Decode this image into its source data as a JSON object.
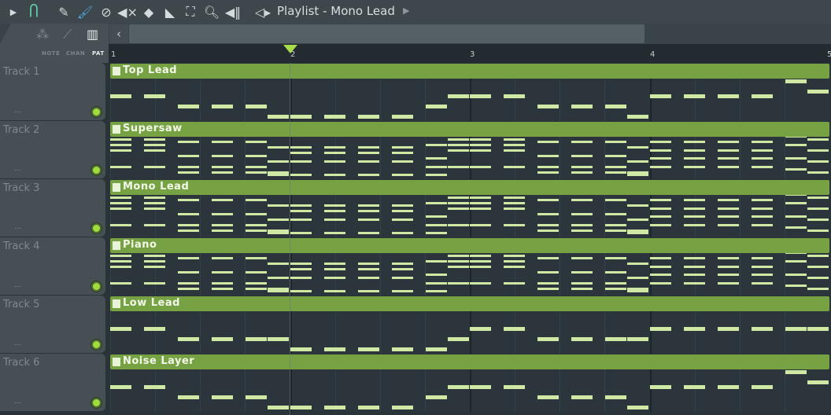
{
  "toolbar": {
    "icons": [
      "play-arrow-icon",
      "magnet-snap-icon",
      "pencil-icon",
      "paint-brush-icon",
      "delete-icon",
      "mute-icon",
      "slip-icon",
      "slice-icon",
      "select-icon",
      "zoom-icon",
      "playback-icon",
      "speaker-icon"
    ],
    "title": "Playlist - Mono Lead",
    "accent": "#5ed3b0",
    "selected_tool_color": "#52a8e0"
  },
  "left_panel": {
    "tabs": [
      "NOTE",
      "CHAN",
      "PAT"
    ],
    "active_tab": "PAT"
  },
  "ruler": {
    "bars": [
      "1",
      "2",
      "3",
      "4",
      "5"
    ],
    "playhead_bar": 2
  },
  "colors": {
    "clip": "#77a243",
    "note": "#cfe8a4",
    "led": "#9fdc3c"
  },
  "tracks": [
    {
      "name": "Track 1",
      "dots": "...",
      "clip": "Top Lead",
      "type": "mono",
      "notes": [
        4,
        4,
        2,
        2,
        2,
        0,
        0,
        0,
        0,
        0,
        2,
        4,
        4,
        4,
        2,
        2,
        2,
        0,
        4,
        4,
        4,
        4,
        7,
        5
      ]
    },
    {
      "name": "Track 2",
      "dots": "...",
      "clip": "Supersaw",
      "type": "chord",
      "notes": [
        [
          13,
          11,
          9,
          3
        ],
        [
          13,
          11,
          9,
          3
        ],
        [
          12,
          7,
          3,
          1
        ],
        [
          12,
          7,
          3,
          1
        ],
        [
          12,
          7,
          3,
          1
        ],
        [
          10,
          5,
          1,
          0
        ],
        [
          10,
          8,
          5,
          0
        ],
        [
          10,
          8,
          5,
          0
        ],
        [
          10,
          8,
          5,
          0
        ],
        [
          10,
          8,
          5,
          0
        ],
        [
          11,
          6,
          3,
          0
        ],
        [
          13,
          11,
          9,
          3
        ],
        [
          13,
          11,
          9,
          3
        ],
        [
          13,
          11,
          9,
          3
        ],
        [
          12,
          7,
          3,
          1
        ],
        [
          12,
          7,
          3,
          1
        ],
        [
          12,
          7,
          3,
          1
        ],
        [
          10,
          5,
          1,
          0
        ],
        [
          12,
          9,
          6,
          3
        ],
        [
          12,
          9,
          6,
          3
        ],
        [
          12,
          9,
          6,
          3
        ],
        [
          12,
          9,
          6,
          3
        ],
        [
          14,
          11,
          6,
          2
        ],
        [
          13,
          9,
          5,
          1
        ]
      ]
    },
    {
      "name": "Track 3",
      "dots": "...",
      "clip": "Mono Lead",
      "type": "chord",
      "notes": [
        [
          13,
          11,
          9,
          3
        ],
        [
          13,
          11,
          9,
          3
        ],
        [
          12,
          7,
          3,
          1
        ],
        [
          12,
          7,
          3,
          1
        ],
        [
          12,
          7,
          3,
          1
        ],
        [
          10,
          5,
          1,
          0
        ],
        [
          10,
          8,
          5,
          0
        ],
        [
          10,
          8,
          5,
          0
        ],
        [
          10,
          8,
          5,
          0
        ],
        [
          10,
          8,
          5,
          0
        ],
        [
          11,
          6,
          3,
          0
        ],
        [
          13,
          11,
          9,
          3
        ],
        [
          13,
          11,
          9,
          3
        ],
        [
          13,
          11,
          9,
          3
        ],
        [
          12,
          7,
          3,
          1
        ],
        [
          12,
          7,
          3,
          1
        ],
        [
          12,
          7,
          3,
          1
        ],
        [
          10,
          5,
          1,
          0
        ],
        [
          12,
          9,
          6,
          3
        ],
        [
          12,
          9,
          6,
          3
        ],
        [
          12,
          9,
          6,
          3
        ],
        [
          12,
          9,
          6,
          3
        ],
        [
          14,
          11,
          6,
          2
        ],
        [
          13,
          9,
          5,
          1
        ]
      ]
    },
    {
      "name": "Track 4",
      "dots": "...",
      "clip": "Piano",
      "type": "chord",
      "notes": [
        [
          13,
          11,
          9,
          3
        ],
        [
          13,
          11,
          9,
          3
        ],
        [
          12,
          7,
          3,
          1
        ],
        [
          12,
          7,
          3,
          1
        ],
        [
          12,
          7,
          3,
          1
        ],
        [
          10,
          5,
          1,
          0
        ],
        [
          10,
          8,
          5,
          0
        ],
        [
          10,
          8,
          5,
          0
        ],
        [
          10,
          8,
          5,
          0
        ],
        [
          10,
          8,
          5,
          0
        ],
        [
          11,
          6,
          3,
          0
        ],
        [
          13,
          11,
          9,
          3
        ],
        [
          13,
          11,
          9,
          3
        ],
        [
          13,
          11,
          9,
          3
        ],
        [
          12,
          7,
          3,
          1
        ],
        [
          12,
          7,
          3,
          1
        ],
        [
          12,
          7,
          3,
          1
        ],
        [
          10,
          5,
          1,
          0
        ],
        [
          12,
          9,
          6,
          3
        ],
        [
          12,
          9,
          6,
          3
        ],
        [
          12,
          9,
          6,
          3
        ],
        [
          12,
          9,
          6,
          3
        ],
        [
          14,
          11,
          6,
          2
        ],
        [
          13,
          9,
          5,
          1
        ]
      ]
    },
    {
      "name": "Track 5",
      "dots": "...",
      "clip": "Low Lead",
      "type": "mono",
      "notes": [
        4,
        4,
        2,
        2,
        2,
        2,
        0,
        0,
        0,
        0,
        0,
        2,
        4,
        4,
        2,
        2,
        2,
        2,
        4,
        4,
        4,
        4,
        4,
        4
      ]
    },
    {
      "name": "Track 6",
      "dots": "...",
      "clip": "Noise Layer",
      "type": "mono",
      "notes": [
        4,
        4,
        2,
        2,
        2,
        0,
        0,
        0,
        0,
        0,
        2,
        4,
        4,
        4,
        2,
        2,
        2,
        0,
        4,
        4,
        4,
        4,
        7,
        5
      ]
    }
  ]
}
